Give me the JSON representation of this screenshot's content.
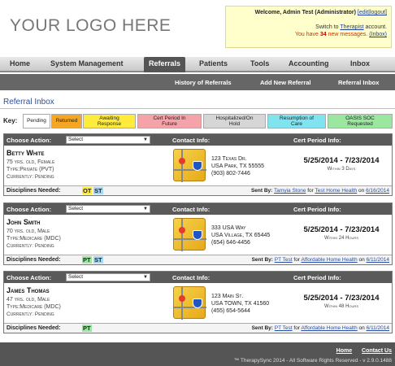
{
  "header": {
    "logo": "YOUR LOGO HERE",
    "welcome": "Welcome, Admin Test",
    "role": "(Administrator)",
    "edit_logout": "[edit|logout]",
    "switch_prefix": "Switch to",
    "switch_link": "Therapist",
    "switch_suffix": "account.",
    "msg_prefix": "You have",
    "msg_count": "34",
    "msg_suffix": "new messages.",
    "inbox_link": "(Inbox)"
  },
  "mainnav": {
    "items": [
      "Home",
      "System Management",
      "Referrals",
      "Patients",
      "Tools",
      "Accounting",
      "Inbox"
    ],
    "active": "Referrals"
  },
  "subnav": {
    "items": [
      "History of Referrals",
      "Add New Referral",
      "Referral Inbox"
    ]
  },
  "page": {
    "title": "Referral Inbox"
  },
  "key": {
    "label": "Key:",
    "items": [
      {
        "label": "Pending",
        "color": "#ffffff"
      },
      {
        "label": "Returned",
        "color": "#f5a623"
      },
      {
        "line1": "Awaiting",
        "line2": "Response",
        "color": "#ffeb3b"
      },
      {
        "line1": "Cert Period In",
        "line2": "Future",
        "color": "#f4a3a8"
      },
      {
        "line1": "Hospitalized/On",
        "line2": "Hold",
        "color": "#d6d6d6"
      },
      {
        "line1": "Resumption of",
        "line2": "Care",
        "color": "#7fe3f0"
      },
      {
        "line1": "OASIS SOC",
        "line2": "Requested",
        "color": "#9be7a0"
      }
    ]
  },
  "cards_common": {
    "choose_action": "Choose Action:",
    "select_value": "Select",
    "contact_info": "Contact Info:",
    "cert_period_info": "Cert Period Info:",
    "disciplines_needed": "Disciplines Needed:",
    "sent_by": "Sent By:"
  },
  "referrals": [
    {
      "name": "Betty White",
      "age_gender": "75 yrs. old, Female",
      "type": "Type:Private (PVT)",
      "status": "Currently: Pending",
      "address1": "123 Texas Dr.",
      "address2": "USA Park, TX 55555",
      "phone": "(903) 802-7446",
      "period": "5/25/2014 - 7/23/2014",
      "within": "Within 3 Days",
      "disciplines": [
        {
          "code": "OT",
          "color": "#ffeb3b"
        },
        {
          "code": "ST",
          "color": "#a7d8f5"
        }
      ],
      "sent_by_person": "Tamyia Stone",
      "sent_by_for": "for",
      "sent_by_org": "Test Home Health",
      "sent_by_on": "on",
      "sent_by_date": "6/16/2014"
    },
    {
      "name": "John Smith",
      "age_gender": "70 yrs. old, Male",
      "type": "Type:Medicare (MDC)",
      "status": "Currently: Pending",
      "address1": "333 USA Way",
      "address2": "USA Village, TX 65445",
      "phone": "(654) 646-4456",
      "period": "5/25/2014 - 7/23/2014",
      "within": "Within 24 Hours",
      "disciplines": [
        {
          "code": "PT",
          "color": "#9be7a0"
        },
        {
          "code": "ST",
          "color": "#a7d8f5"
        }
      ],
      "sent_by_person": "PT Test",
      "sent_by_for": "for",
      "sent_by_org": "Affordable Home Health",
      "sent_by_on": "on",
      "sent_by_date": "6/11/2014"
    },
    {
      "name": "James Thomas",
      "age_gender": "47 yrs. old, Male",
      "type": "Type:Medicare (MDC)",
      "status": "Currently: Pending",
      "address1": "123 Main St.",
      "address2": "USA TOWN, TX 41560",
      "phone": "(455) 654-5644",
      "period": "5/25/2014 - 7/23/2014",
      "within": "Within 48 Hours",
      "disciplines": [
        {
          "code": "PT",
          "color": "#9be7a0"
        }
      ],
      "sent_by_person": "PT Test",
      "sent_by_for": "for",
      "sent_by_org": "Affordable Home Health",
      "sent_by_on": "on",
      "sent_by_date": "6/11/2014"
    }
  ],
  "footer": {
    "home": "Home",
    "contact": "Contact Us",
    "copyright": "™ TherapySync 2014 - All Software Rights Reserved - v 2.9.0.1488"
  }
}
